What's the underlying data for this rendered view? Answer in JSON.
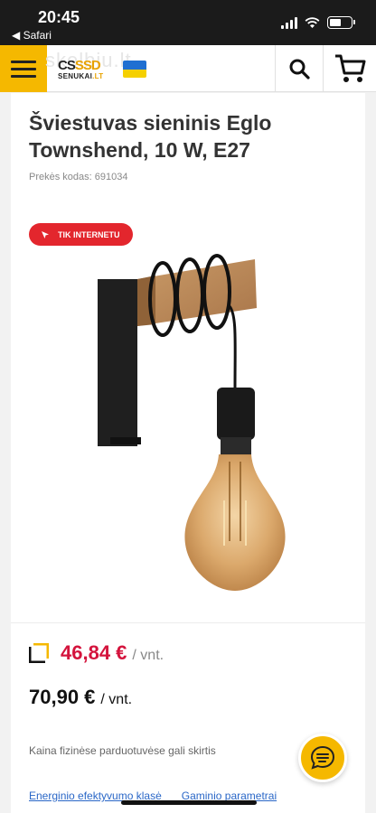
{
  "status_bar": {
    "time": "20:45",
    "back_label": "◀ Safari"
  },
  "header": {
    "logo_text": "CS",
    "logo_suffix": "SSD",
    "logo_sub": "SENUKAI",
    "logo_sub_suffix": ".LT",
    "watermark": "skelbiu.lt",
    "icons": [
      "menu-icon",
      "search-icon",
      "cart-icon"
    ]
  },
  "product": {
    "title": "Šviestuvas sieninis Eglo Townshend, 10 W, E27",
    "sku": "Prekės kodas: 691034",
    "badge": "TIK INTERNETU",
    "price_card": "46,84 €",
    "price_card_unit": "/ vnt.",
    "price_regular": "70,90 €",
    "price_regular_unit": "/ vnt.",
    "store_note": "Kaina fizinėse parduotuvėse gali skirtis",
    "link_energy": "Energinio efektyvumo klasė",
    "link_params": "Gaminio parametrai"
  },
  "colors": {
    "brand_yellow": "#f5b800",
    "badge_red": "#e3262d",
    "price_red": "#d4143d",
    "link_blue": "#2a67c7"
  }
}
